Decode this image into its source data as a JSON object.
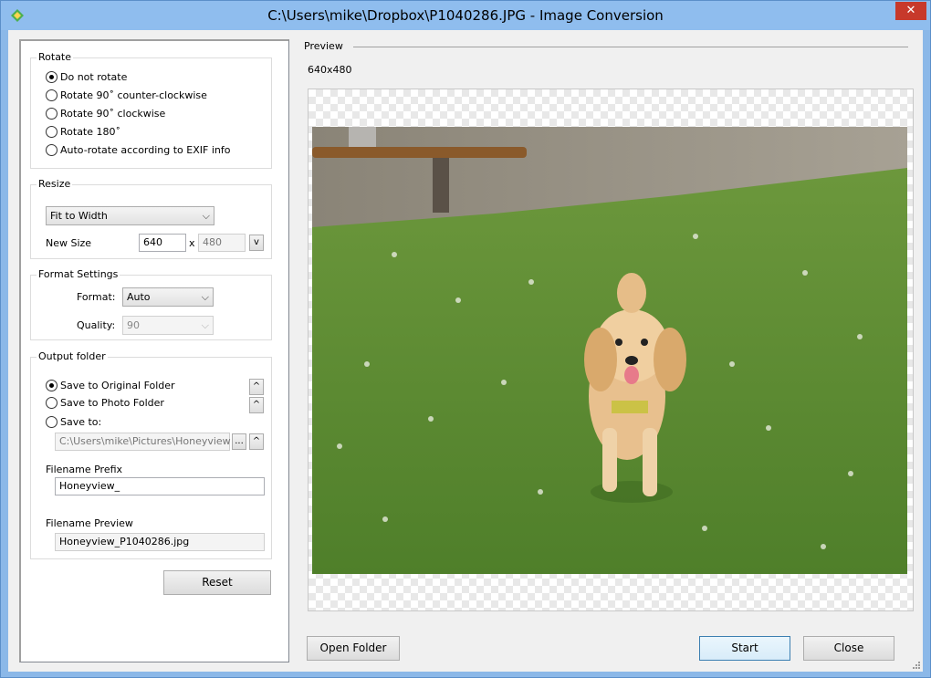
{
  "window": {
    "title": "C:\\Users\\mike\\Dropbox\\P1040286.JPG - Image Conversion",
    "close_glyph": "✕"
  },
  "rotate": {
    "label": "Rotate",
    "options": [
      {
        "label": "Do not rotate",
        "checked": true
      },
      {
        "label": "Rotate 90˚ counter-clockwise",
        "checked": false
      },
      {
        "label": "Rotate 90˚ clockwise",
        "checked": false
      },
      {
        "label": "Rotate 180˚",
        "checked": false
      },
      {
        "label": "Auto-rotate according to EXIF info",
        "checked": false
      }
    ]
  },
  "resize": {
    "label": "Resize",
    "mode": "Fit to Width",
    "new_size_label": "New Size",
    "width": "640",
    "x_sep": "x",
    "height": "480",
    "v_button": "v"
  },
  "format": {
    "label": "Format Settings",
    "format_label": "Format:",
    "format_value": "Auto",
    "quality_label": "Quality:",
    "quality_value": "90"
  },
  "output": {
    "label": "Output folder",
    "options": [
      {
        "label": "Save to Original Folder",
        "checked": true
      },
      {
        "label": "Save to Photo Folder",
        "checked": false
      },
      {
        "label": "Save to:",
        "checked": false
      }
    ],
    "path": "C:\\Users\\mike\\Pictures\\Honeyview",
    "browse": "...",
    "up_glyph": "^",
    "prefix_label": "Filename Prefix",
    "prefix_value": "Honeyview_",
    "preview_label": "Filename Preview",
    "preview_value": "Honeyview_P1040286.jpg"
  },
  "buttons": {
    "reset": "Reset",
    "open_folder": "Open Folder",
    "start": "Start",
    "close": "Close"
  },
  "preview": {
    "label": "Preview",
    "size": "640x480"
  }
}
